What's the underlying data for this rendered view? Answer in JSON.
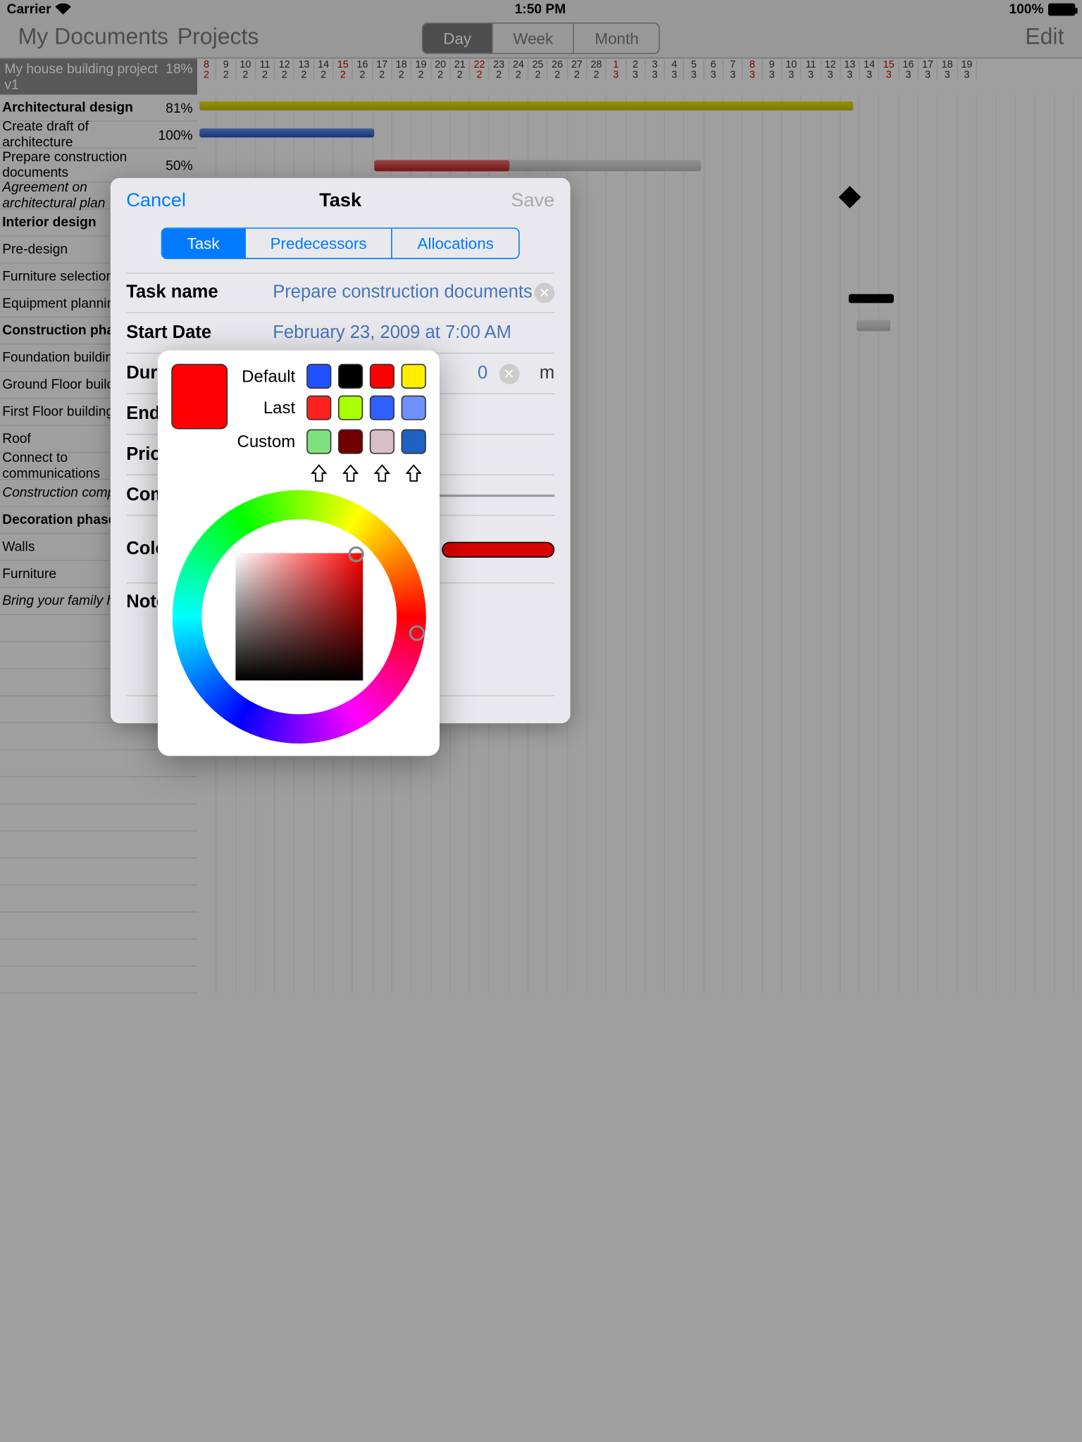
{
  "status": {
    "carrier": "Carrier",
    "time": "1:50 PM",
    "battery": "100%"
  },
  "nav": {
    "back1": "My Documents",
    "back2": "Projects",
    "day": "Day",
    "week": "Week",
    "month": "Month",
    "edit": "Edit"
  },
  "project": {
    "name": "My house building project v1",
    "pct": "18%"
  },
  "days": [
    {
      "d": "8",
      "w": "2",
      "red": true
    },
    {
      "d": "9",
      "w": "2"
    },
    {
      "d": "10",
      "w": "2"
    },
    {
      "d": "11",
      "w": "2"
    },
    {
      "d": "12",
      "w": "2"
    },
    {
      "d": "13",
      "w": "2"
    },
    {
      "d": "14",
      "w": "2"
    },
    {
      "d": "15",
      "w": "2",
      "red": true
    },
    {
      "d": "16",
      "w": "2"
    },
    {
      "d": "17",
      "w": "2"
    },
    {
      "d": "18",
      "w": "2"
    },
    {
      "d": "19",
      "w": "2"
    },
    {
      "d": "20",
      "w": "2"
    },
    {
      "d": "21",
      "w": "2"
    },
    {
      "d": "22",
      "w": "2",
      "red": true
    },
    {
      "d": "23",
      "w": "2"
    },
    {
      "d": "24",
      "w": "2"
    },
    {
      "d": "25",
      "w": "2"
    },
    {
      "d": "26",
      "w": "2"
    },
    {
      "d": "27",
      "w": "2"
    },
    {
      "d": "28",
      "w": "2"
    },
    {
      "d": "1",
      "w": "3",
      "red": true
    },
    {
      "d": "2",
      "w": "3"
    },
    {
      "d": "3",
      "w": "3"
    },
    {
      "d": "4",
      "w": "3"
    },
    {
      "d": "5",
      "w": "3"
    },
    {
      "d": "6",
      "w": "3"
    },
    {
      "d": "7",
      "w": "3"
    },
    {
      "d": "8",
      "w": "3",
      "red": true
    },
    {
      "d": "9",
      "w": "3"
    },
    {
      "d": "10",
      "w": "3"
    },
    {
      "d": "11",
      "w": "3"
    },
    {
      "d": "12",
      "w": "3"
    },
    {
      "d": "13",
      "w": "3"
    },
    {
      "d": "14",
      "w": "3"
    },
    {
      "d": "15",
      "w": "3",
      "red": true
    },
    {
      "d": "16",
      "w": "3"
    },
    {
      "d": "17",
      "w": "3"
    },
    {
      "d": "18",
      "w": "3"
    },
    {
      "d": "19",
      "w": "3"
    }
  ],
  "tasks": [
    {
      "name": "Architectural design",
      "pct": "81%",
      "bold": true
    },
    {
      "name": "Create draft of architecture",
      "pct": "100%"
    },
    {
      "name": "Prepare construction documents",
      "pct": "50%",
      "double": true
    },
    {
      "name": "Agreement on architectural plan",
      "italic": true
    },
    {
      "name": "Interior design",
      "bold": true
    },
    {
      "name": "Pre-design"
    },
    {
      "name": "Furniture selection"
    },
    {
      "name": "Equipment planning"
    },
    {
      "name": "Construction phase",
      "bold": true
    },
    {
      "name": "Foundation building"
    },
    {
      "name": "Ground Floor building"
    },
    {
      "name": "First Floor building"
    },
    {
      "name": "Roof"
    },
    {
      "name": "Connect to communications"
    },
    {
      "name": "Construction completed",
      "italic": true
    },
    {
      "name": "Decoration phase",
      "bold": true
    },
    {
      "name": "Walls"
    },
    {
      "name": "Furniture"
    },
    {
      "name": "Bring your family here",
      "italic": true
    }
  ],
  "modal": {
    "cancel": "Cancel",
    "title": "Task",
    "save": "Save",
    "tabs": {
      "task": "Task",
      "pred": "Predecessors",
      "alloc": "Allocations"
    },
    "fields": {
      "name_label": "Task name",
      "name_value": "Prepare construction documents",
      "start_label": "Start Date",
      "start_value": "February 23, 2009 at 7:00 AM",
      "duration_label": "Duration",
      "duration_value": "0",
      "duration_unit": "m",
      "end_label": "End Date",
      "priority_label": "Priority",
      "complete_label": "Complete",
      "color_label": "Color",
      "note_label": "Note"
    }
  },
  "picker": {
    "default_label": "Default",
    "last_label": "Last",
    "custom_label": "Custom",
    "current": "#ff0000",
    "default_colors": [
      "#2050ff",
      "#000000",
      "#ff0000",
      "#ffee00"
    ],
    "last_colors": [
      "#ff2020",
      "#aaff00",
      "#3060ff",
      "#7090ff"
    ],
    "custom_colors": [
      "#80e080",
      "#700000",
      "#d8c0c8",
      "#2060c0"
    ]
  }
}
